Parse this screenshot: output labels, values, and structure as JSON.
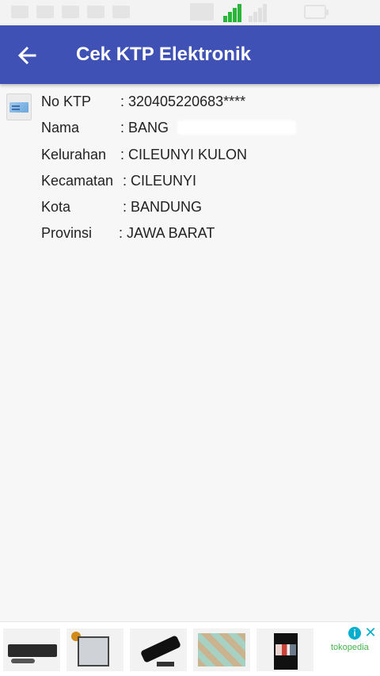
{
  "app_bar": {
    "title": "Cek KTP Elektronik",
    "back_icon": "arrow-left-icon",
    "color": "#3f51b5"
  },
  "ktp": {
    "rows": [
      {
        "label": "No KTP",
        "value": ": 320405220683****"
      },
      {
        "label": "Nama",
        "value": ": BANG"
      },
      {
        "label": "Kelurahan",
        "value": ": CILEUNYI KULON"
      },
      {
        "label": "Kecamatan",
        "value": ": CILEUNYI"
      },
      {
        "label": "Kota",
        "value": ": BANDUNG"
      },
      {
        "label": "Provinsi",
        "value": ": JAWA BARAT"
      }
    ]
  },
  "ad": {
    "brand": "tokopedia",
    "info_glyph": "i",
    "close_glyph": "✕",
    "brand_color": "#42b549"
  }
}
